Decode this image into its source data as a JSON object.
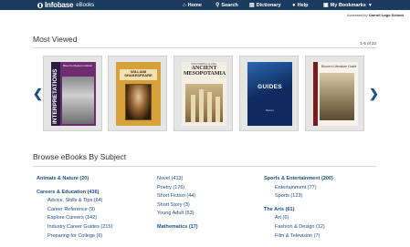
{
  "header": {
    "logo": "Infobase",
    "logo_sub": "eBooks",
    "nav": [
      {
        "label": "Home",
        "icon": "home-icon"
      },
      {
        "label": "Search",
        "icon": "search-icon"
      },
      {
        "label": "Dictionary",
        "icon": "dictionary-icon"
      },
      {
        "label": "Help",
        "icon": "help-icon"
      },
      {
        "label": "My Bookmarks",
        "icon": "bookmark-icon"
      }
    ],
    "accessed_by_label": "Accessed by",
    "accessed_by_value": "Carroll Logo School"
  },
  "most_viewed": {
    "title": "Most Viewed",
    "page_count": "1-5 of 23",
    "books": [
      {
        "cover_title": "INTERPRETATIONS",
        "cover_top": "Bloom's Modern Critical"
      },
      {
        "cover_title": "WILLIAM SHAKESPEARE"
      },
      {
        "cover_title": "ANCIENT MESOPOTAMIA",
        "cover_top": "DISCOVERING GLOBAL"
      },
      {
        "cover_title": "GUIDES",
        "cover_sub": "Bloom's"
      },
      {
        "cover_title": "Bloom's Literature Guide"
      }
    ]
  },
  "browse": {
    "title": "Browse eBooks By Subject",
    "col1": {
      "cat1": "Animals & Nature (20)",
      "cat2": "Careers & Education (436)",
      "subs": [
        "Advice, Skills & Tips (64)",
        "Career Reference (9)",
        "Explore Careers (142)",
        "Industry Career Guides (215)",
        "Preparing for College (6)"
      ]
    },
    "col2": {
      "links": [
        "Novel (413)",
        "Poetry (176)",
        "Short Fiction (44)",
        "Short Story (3)",
        "Young Adult (63)"
      ],
      "cat": "Mathematics (17)"
    },
    "col3": {
      "cat1": "Sports & Entertainment (200)",
      "subs1": [
        "Entertainment (77)",
        "Sports (123)"
      ],
      "cat2": "The Arts (61)",
      "subs2": [
        "Art (6)",
        "Fashion & Design (12)",
        "Film & Television (7)"
      ]
    }
  }
}
